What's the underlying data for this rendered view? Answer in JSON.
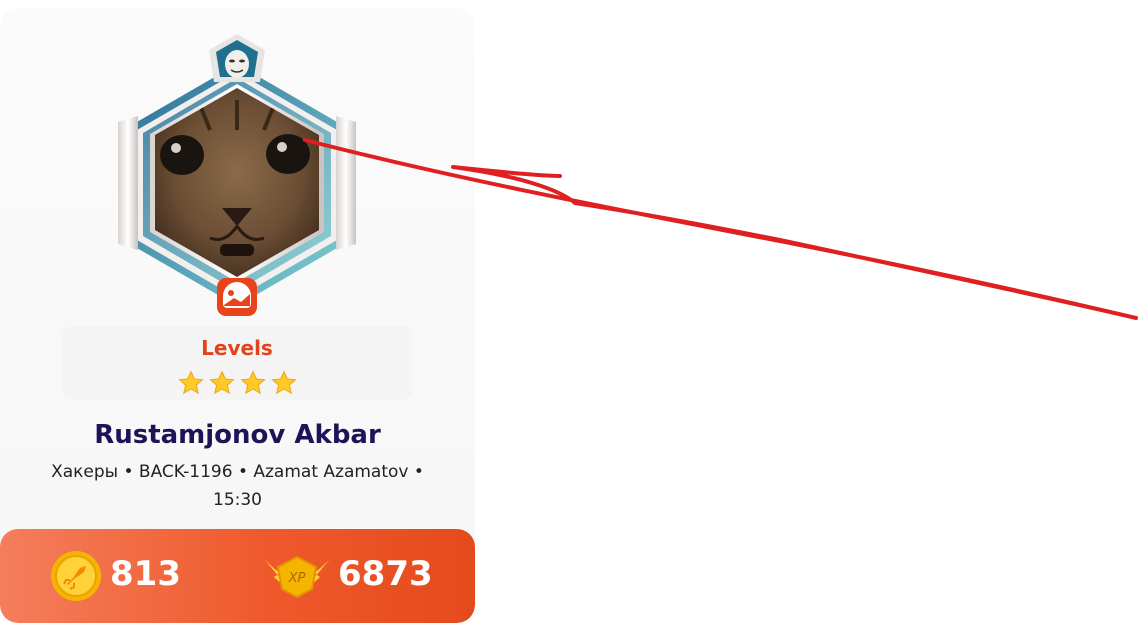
{
  "profile": {
    "levels_title": "Levels",
    "stars": [
      1,
      1,
      1,
      1
    ],
    "name": "Rustamjonov Akbar",
    "meta": "Хакеры • BACK-1196 • Azamat Azamatov • 15:30",
    "badge": {
      "rank_icon": "mask-icon",
      "avatar": "cat-photo",
      "edit_icon": "image-edit-icon"
    }
  },
  "stats": {
    "coins": "813",
    "xp": "6873",
    "xp_badge_text": "XP"
  },
  "colors": {
    "accent": "#e3421a",
    "name": "#1d1457",
    "stats_bar": "#ef5a2d",
    "annotation": "#e02020"
  }
}
